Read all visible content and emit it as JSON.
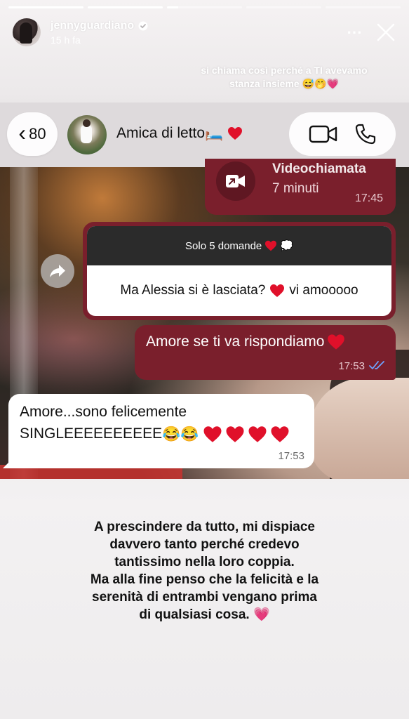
{
  "progress": {
    "segments": [
      {
        "fill_percent": 100
      },
      {
        "fill_percent": 100
      },
      {
        "fill_percent": 15
      },
      {
        "fill_percent": 0
      },
      {
        "fill_percent": 0
      }
    ]
  },
  "header": {
    "username": "jennyguardiano",
    "time_ago": "15 h fa",
    "more_icon": "⋯",
    "verified_icon": "verified-badge-icon",
    "close_icon": "close-icon"
  },
  "caption": {
    "line1": "si chiama così perché a TI avevamo",
    "line2": "stanza insieme 😅🤭💗"
  },
  "chat_header": {
    "back_chevron": "‹",
    "unread_count": "80",
    "contact_name": "Amica di letto🛏️",
    "video_call_icon": "video-call-icon",
    "phone_icon": "phone-icon"
  },
  "messages": {
    "video_call": {
      "title": "Videochiamata",
      "duration": "7 minuti",
      "time": "17:45"
    },
    "reply": {
      "question_header": "Solo 5 domande",
      "question_emoji": "💭",
      "question_text": "Ma Alessia si è lasciata?",
      "question_suffix": "vi amooooo"
    },
    "outgoing": {
      "text": "Amore se ti va rispondiamo",
      "time": "17:53"
    },
    "incoming": {
      "line1": "Amore...sono felicemente",
      "line2": "SINGLEEEEEEEEEE",
      "laugh_emoji": "😂😂",
      "time": "17:53"
    }
  },
  "bottom_text": {
    "line1": "A prescindere da tutto, mi dispiace",
    "line2": "davvero tanto perché credevo",
    "line3": "tantissimo nella loro coppia.",
    "line4": "Ma alla fine penso che la felicità e la",
    "line5": "serenità di entrambi vengano prima",
    "line6": "di qualsiasi cosa. 💗"
  },
  "colors": {
    "outgoing_bubble": "#7a1f2c",
    "heart": "#e0102a",
    "tick_blue": "#6fa3ff"
  }
}
